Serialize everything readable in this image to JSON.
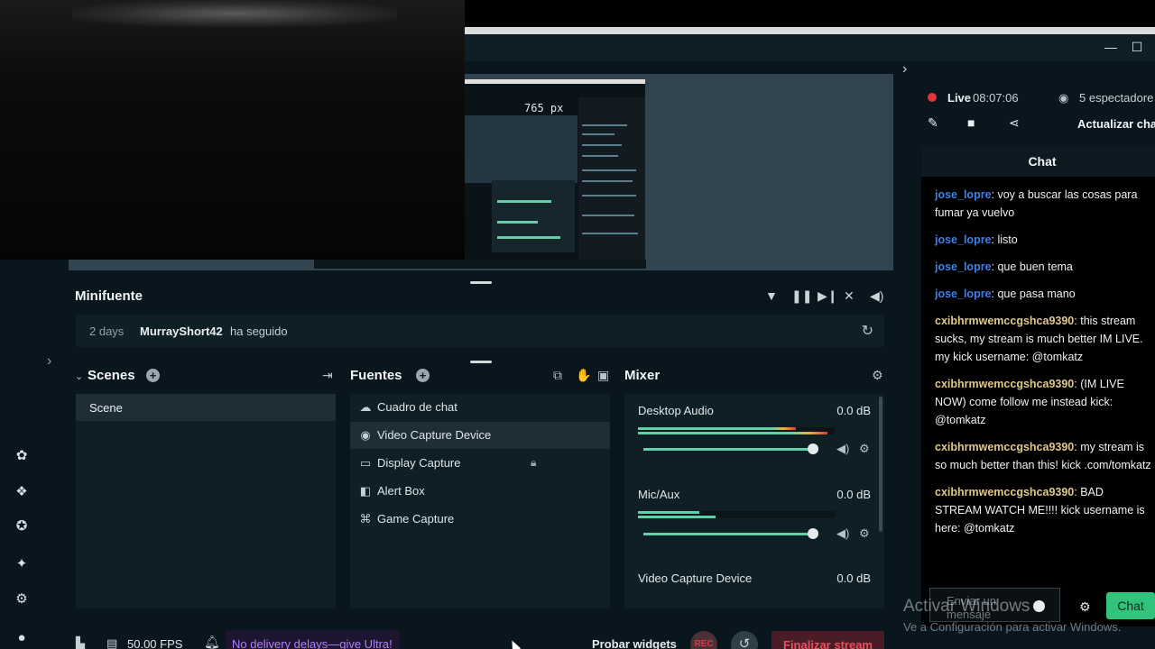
{
  "window": {
    "minimize_glyph": "—",
    "maximize_glyph": "☐"
  },
  "preview": {
    "nested_px_label": "765 px"
  },
  "minifuente": {
    "title": "Minifuente",
    "event": {
      "time": "2 days",
      "user": "MurrayShort42",
      "action": "ha seguido"
    }
  },
  "scenes": {
    "title": "Scenes",
    "items": [
      "Scene"
    ]
  },
  "sources": {
    "title": "Fuentes",
    "items": [
      {
        "label": "Cuadro de chat",
        "icon": "chat-bubbles-icon"
      },
      {
        "label": "Video Capture Device",
        "icon": "webcam-icon",
        "selected": true
      },
      {
        "label": "Display Capture",
        "icon": "monitor-icon",
        "locked": true
      },
      {
        "label": "Alert Box",
        "icon": "alert-box-icon"
      },
      {
        "label": "Game Capture",
        "icon": "gamepad-icon"
      }
    ]
  },
  "mixer": {
    "title": "Mixer",
    "channels": [
      {
        "name": "Desktop Audio",
        "db": "0.0 dB",
        "level": 0.92
      },
      {
        "name": "Mic/Aux",
        "db": "0.0 dB",
        "level": 0.92
      },
      {
        "name": "Video Capture Device",
        "db": "0.0 dB"
      }
    ]
  },
  "footer": {
    "fps": "50.00 FPS",
    "promo": "No delivery delays—give Ultra!",
    "test_widgets": "Probar widgets",
    "rec": "REC",
    "end_stream": "Finalizar stream"
  },
  "stream": {
    "live_label": "Live",
    "live_time": "08:07:06",
    "viewers": "5 espectadore",
    "refresh_chat": "Actualizar cha"
  },
  "chat": {
    "title": "Chat",
    "messages": [
      {
        "user": "jose_lopre",
        "sep": ": ",
        "text": "voy a buscar las cosas para fumar ya vuelvo",
        "color": "#3f7fe6"
      },
      {
        "user": "jose_lopre",
        "sep": ": ",
        "text": "listo",
        "color": "#3f7fe6"
      },
      {
        "user": "jose_lopre",
        "sep": ": ",
        "text": "que buen tema",
        "color": "#3f7fe6"
      },
      {
        "user": "jose_lopre",
        "sep": ": ",
        "text": "que pasa mano",
        "color": "#3f7fe6"
      },
      {
        "user": "cxibhrmwemccgshca9390",
        "sep": ": ",
        "text": "this stream sucks, my stream is much better IM LIVE. my kick username: @tomkatz",
        "color": "#e0c88a"
      },
      {
        "user": "cxibhrmwemccgshca9390",
        "sep": ": ",
        "text": "(IM LIVE NOW) come follow me instead kick: @tomkatz",
        "color": "#e0c88a"
      },
      {
        "user": "cxibhrmwemccgshca9390",
        "sep": ": ",
        "text": "my stream is so much better than this! kick .com/tomkatz",
        "color": "#e0c88a"
      },
      {
        "user": "cxibhrmwemccgshca9390",
        "sep": ": ",
        "text": "BAD STREAM WATCH ME!!!! kick username is here: @tomkatz",
        "color": "#e0c88a"
      }
    ],
    "input_placeholder": "Enviar un mensaje",
    "send_label": "Chat"
  },
  "watermark": {
    "line1": "Activar Windows",
    "line2": "Ve a Configuración para activar Windows."
  },
  "colors": {
    "accent": "#31c27c",
    "live": "#e2343f",
    "promo": "#b37dff",
    "end_stream": "#ec4e5f"
  }
}
